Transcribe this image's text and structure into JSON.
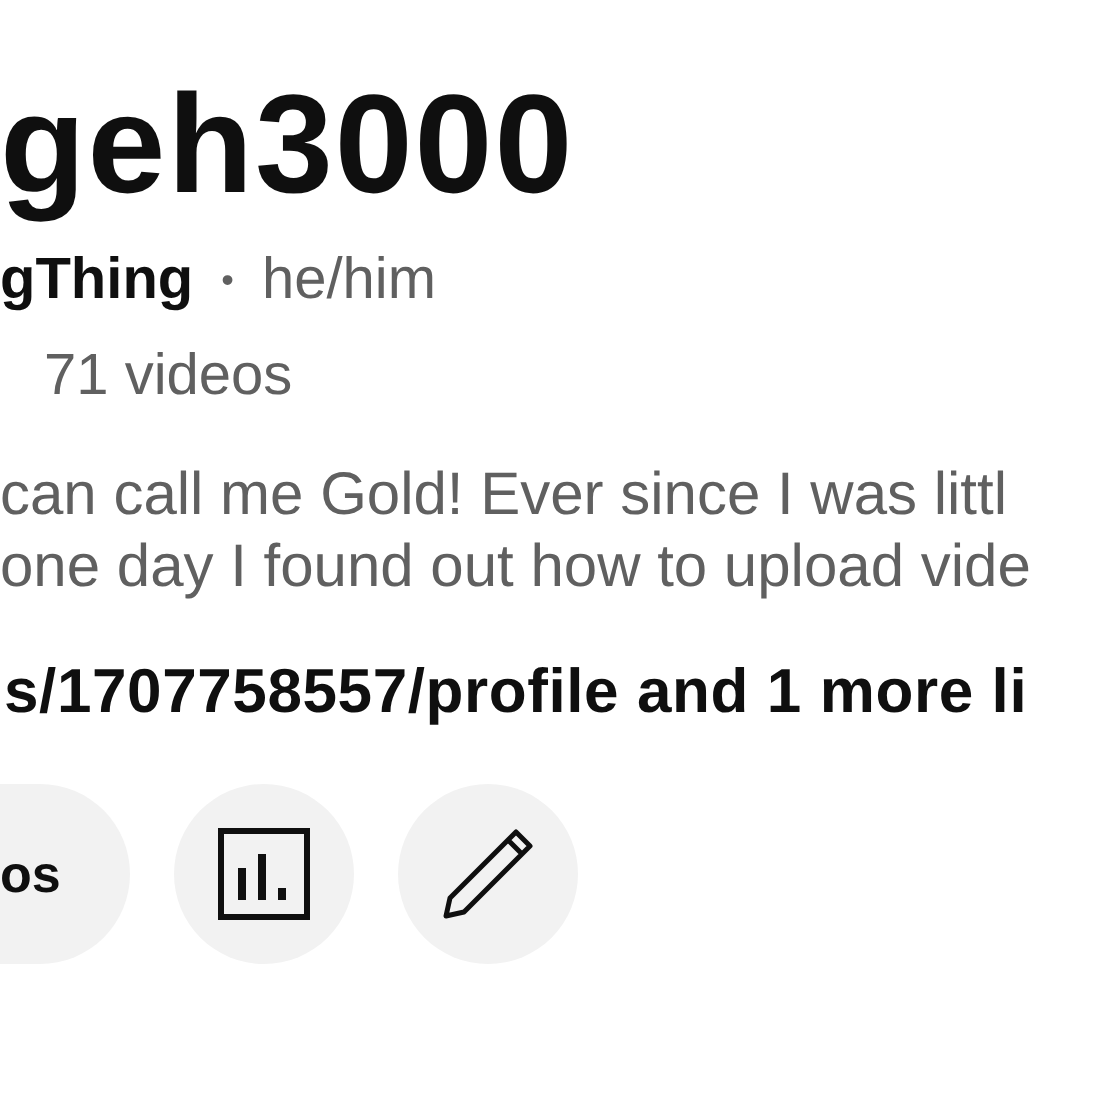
{
  "channel": {
    "name": "geh3000",
    "handle": "gThing",
    "separator": "•",
    "pronouns": "he/him",
    "video_count": "71 videos"
  },
  "description": {
    "lines": [
      "can call me Gold! Ever since I was littl",
      "one day I found out how to upload vide"
    ]
  },
  "link": {
    "text": "s/1707758557/profile and 1 more li"
  },
  "actions": [
    {
      "kind": "pill",
      "label": "os"
    },
    {
      "kind": "chart"
    },
    {
      "kind": "pencil"
    }
  ]
}
